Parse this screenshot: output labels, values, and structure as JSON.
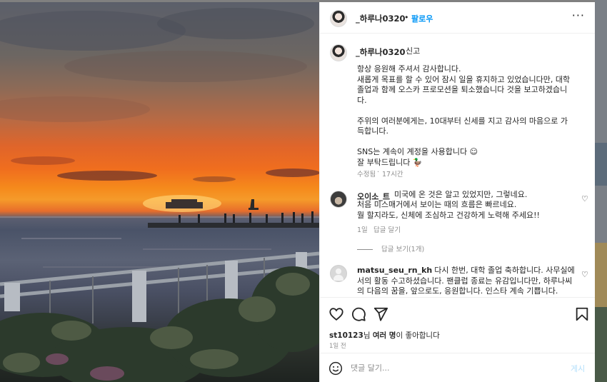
{
  "header": {
    "username": "_하루나0320",
    "separator": "•",
    "follow_label": "팔로우",
    "more_label": "···"
  },
  "caption": {
    "username": "_하루나0320",
    "report_label": "신고",
    "body": "항상 응원해 주셔서 감사합니다.\n새롭게 목표를 할 수 있어 잠시 일을 휴지하고 있었습니다만, 대학 졸업과 함께 오스카 프로모션을 퇴소했습니다 것을 보고하겠습니다.\n\n주위의 여러분에게는, 10대부터 신세를 지고 감사의 마음으로 가득합니다.\n\nSNS는 계속이 계정을 사용합니다 ☺\n잘 부탁드립니다 🦆",
    "edited_label": "수정됨",
    "separator": "·",
    "time": "17시간"
  },
  "comments": [
    {
      "username": "오이소_트",
      "text": "미국에 온 것은 알고 있었지만, 그렇네요.",
      "body": "처음 미스매거에서 보이는 때의 흐름은 빠르네요.\n뭘 할지라도, 신체에 조심하고 건강하게 노력해 주세요!!",
      "time": "1일",
      "reply_label": "답글 달기",
      "view_replies_label": "답글 보기(1개)"
    },
    {
      "username": "matsu_seu_rn_kh",
      "text": "다시 한번, 대학 졸업 축하합니다. 사무실에서의 활동 수고하셨습니다. 팬클럽 종료는 유감입니다만, 하루나씨의 다음의 꿈을, 앞으로도, 응원합니다. 인스타 계속 기쁩니다."
    }
  ],
  "actions": {
    "likes_user": "st10123",
    "likes_mid": "님 ",
    "likes_bold": "여러 명",
    "likes_suffix": "이 좋아합니다",
    "time": "1일 전"
  },
  "comment_bar": {
    "placeholder": "댓글 달기...",
    "post_label": "게시"
  },
  "icons": {
    "heart": "heart-icon",
    "comment": "comment-icon",
    "share": "share-icon",
    "bookmark": "bookmark-icon",
    "emoji": "emoji-icon"
  },
  "colors": {
    "follow": "#0095f6",
    "post_disabled": "#b2dffc",
    "meta": "#8e8e8e"
  }
}
